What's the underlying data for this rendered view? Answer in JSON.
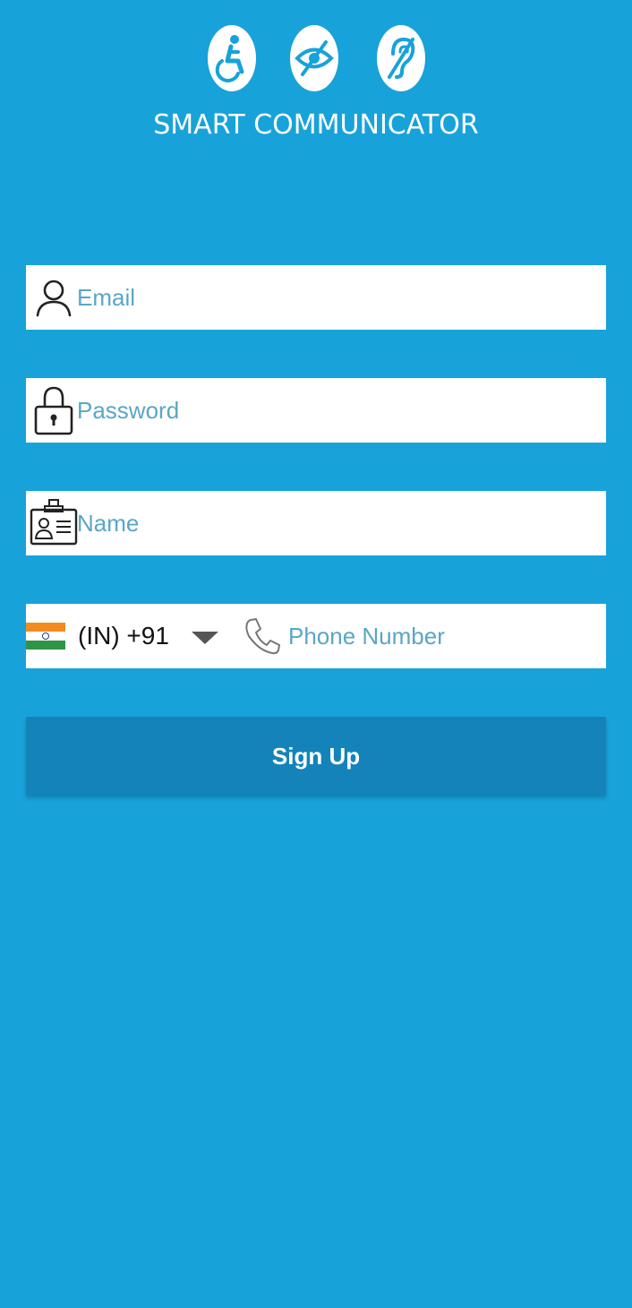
{
  "header": {
    "app_title": "SMART COMMUNICATOR",
    "logo_icons": [
      "accessible-wheelchair-icon",
      "low-vision-icon",
      "hearing-impaired-icon"
    ]
  },
  "form": {
    "email": {
      "placeholder": "Email",
      "value": "",
      "icon": "user-icon"
    },
    "password": {
      "placeholder": "Password",
      "value": "",
      "icon": "lock-icon"
    },
    "name": {
      "placeholder": "Name",
      "value": "",
      "icon": "id-card-icon"
    },
    "phone": {
      "country_flag": "india-flag-icon",
      "country_code": "(IN) +91",
      "dropdown_icon": "caret-down-icon",
      "icon": "phone-icon",
      "placeholder": "Phone Number",
      "value": ""
    },
    "signup_label": "Sign Up"
  },
  "colors": {
    "background": "#18a2da",
    "button": "#1483ba",
    "placeholder": "#5aa6c6",
    "field": "#ffffff"
  }
}
